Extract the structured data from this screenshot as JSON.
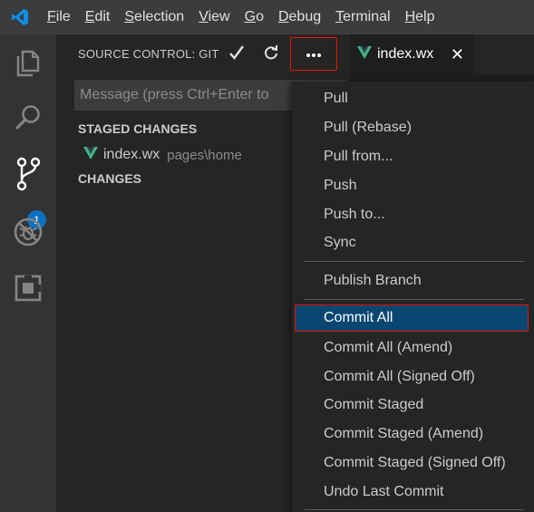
{
  "menubar": {
    "items": [
      {
        "mnemonic": "F",
        "rest": "ile"
      },
      {
        "mnemonic": "E",
        "rest": "dit"
      },
      {
        "mnemonic": "S",
        "rest": "election"
      },
      {
        "mnemonic": "V",
        "rest": "iew"
      },
      {
        "mnemonic": "G",
        "rest": "o"
      },
      {
        "mnemonic": "D",
        "rest": "ebug"
      },
      {
        "mnemonic": "T",
        "rest": "erminal"
      },
      {
        "mnemonic": "H",
        "rest": "elp"
      }
    ]
  },
  "activitybar": {
    "icons": [
      "files-icon",
      "search-icon",
      "source-control-icon",
      "debug-icon",
      "extensions-icon"
    ],
    "scm_badge": "1"
  },
  "sidebar": {
    "title": "SOURCE CONTROL: GIT",
    "commit_icon": "checkmark-icon",
    "refresh_icon": "refresh-icon",
    "more_label": "···",
    "message_placeholder": "Message (press Ctrl+Enter to",
    "staged_header": "STAGED CHANGES",
    "staged_file": {
      "name": "index.wx",
      "path": "pages\\home"
    },
    "changes_header": "CHANGES"
  },
  "editor": {
    "tab_label": "index.wx",
    "tab_close": "✕"
  },
  "context_menu": {
    "items": [
      "Pull",
      "Pull (Rebase)",
      "Pull from...",
      "Push",
      "Push to...",
      "Sync",
      "Publish Branch",
      "Commit All",
      "Commit All (Amend)",
      "Commit All (Signed Off)",
      "Commit Staged",
      "Commit Staged (Amend)",
      "Commit Staged (Signed Off)",
      "Undo Last Commit"
    ],
    "selected": "Commit All"
  },
  "colors": {
    "accent": "#0e70c0",
    "vue_green": "#41b883",
    "highlight_border": "#e51400",
    "selection": "#094771"
  }
}
